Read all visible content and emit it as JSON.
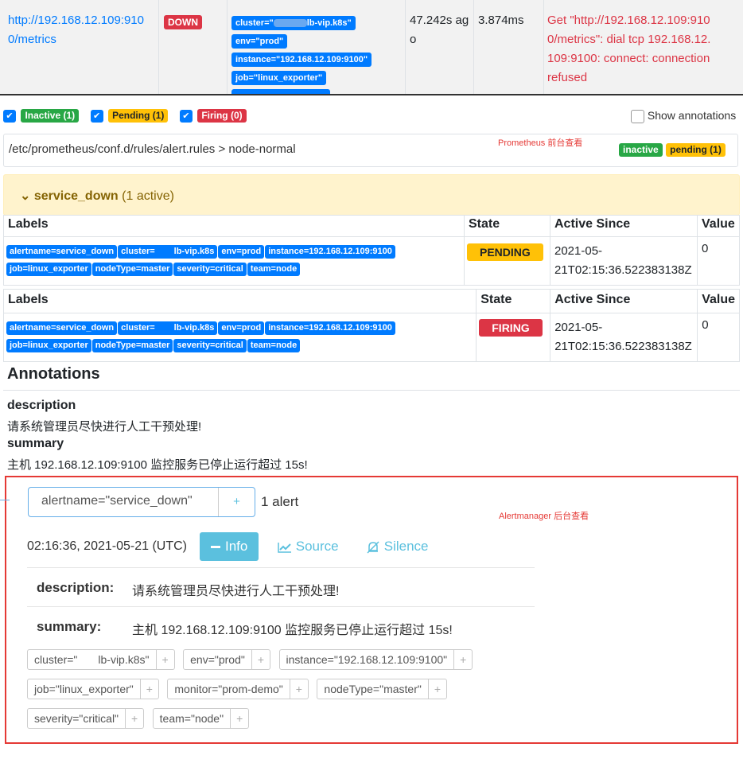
{
  "target": {
    "endpoint": "http://192.168.12.109:9100/metrics",
    "endpoint_line1": "http://192.168.12.109:910",
    "endpoint_line2": "0/metrics",
    "state": "DOWN",
    "labels": [
      "cluster=\"",
      "lb-vip.k8s\"",
      "env=\"prod\"",
      "instance=\"192.168.12.109:9100\"",
      "job=\"linux_exporter\""
    ],
    "last_scrape_l1": "47.242s ag",
    "last_scrape_l2": "o",
    "duration": "3.874ms",
    "error_l1": "Get \"http://192.168.12.109:910",
    "error_l2": "0/metrics\": dial tcp 192.168.12.",
    "error_l3": "109:9100: connect: connection",
    "error_l4": "refused"
  },
  "filters": {
    "inactive": "Inactive (1)",
    "pending": "Pending (1)",
    "firing": "Firing (0)",
    "show_annotations": "Show annotations"
  },
  "rule_group": {
    "path": "/etc/prometheus/conf.d/rules/alert.rules > node-normal",
    "note": "Prometheus 前台查看",
    "badge_inactive": "inactive",
    "badge_pending": "pending (1)"
  },
  "alert_rule": {
    "name": "service_down",
    "count": "(1 active)"
  },
  "tables": {
    "col_labels": "Labels",
    "col_state": "State",
    "col_active": "Active Since",
    "col_value": "Value",
    "labels_row1": [
      "alertname=service_down",
      "cluster=",
      "lb-vip.k8s",
      "env=prod",
      "instance=192.168.12.109:9100"
    ],
    "labels_row2": [
      "job=linux_exporter",
      "nodeType=master",
      "severity=critical",
      "team=node"
    ],
    "pending": {
      "state": "PENDING",
      "active_l1": "2021-05-",
      "active_l2": "21T02:15:36.522383138Z",
      "value": "0"
    },
    "firing": {
      "state": "FIRING",
      "active_l1": "2021-05-",
      "active_l2": "21T02:15:36.522383138Z",
      "value": "0"
    }
  },
  "annotations": {
    "heading": "Annotations",
    "desc_key": "description",
    "desc_val": "请系统管理员尽快进行人工干预处理!",
    "summary_key": "summary",
    "summary_val": "主机 192.168.12.109:9100 监控服务已停止运行超过 15s!"
  },
  "alertmanager": {
    "filter_value": "alertname=\"service_down\"",
    "filter_plus": "+",
    "alert_count": "1 alert",
    "note": "Alertmanager  后台查看",
    "timestamp": "02:16:36, 2021-05-21 (UTC)",
    "btn_info": "Info",
    "btn_source": "Source",
    "btn_silence": "Silence",
    "desc_key": "description:",
    "desc_val": "请系统管理员尽快进行人工干预处理!",
    "summary_key": "summary:",
    "summary_val": "主机 192.168.12.109:9100 监控服务已停止运行超过 15s!",
    "tags": [
      "cluster=\"",
      "lb-vip.k8s\"",
      "env=\"prod\"",
      "instance=\"192.168.12.109:9100\"",
      "job=\"linux_exporter\"",
      "monitor=\"prom-demo\"",
      "nodeType=\"master\"",
      "severity=\"critical\"",
      "team=\"node\""
    ]
  }
}
